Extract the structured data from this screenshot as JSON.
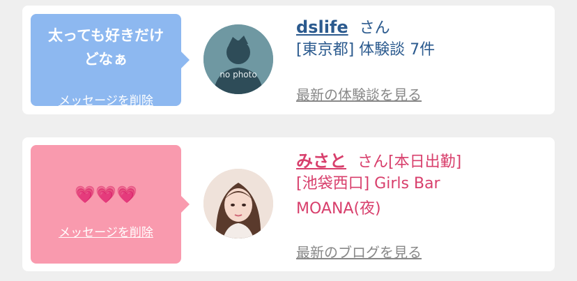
{
  "cards": [
    {
      "message_lines": [
        "太っても好きだけ",
        "どなぁ"
      ],
      "delete_label": "メッセージを削除",
      "avatar_caption": "no photo",
      "name": "dslife",
      "honorific": "さん",
      "details": [
        "[東京都] 体験談 7件"
      ],
      "link_label": "最新の体験談を見る"
    },
    {
      "message_lines": [
        "💗💗💗"
      ],
      "delete_label": "メッセージを削除",
      "name": "みさと",
      "honorific": "さん[本日出勤]",
      "details": [
        "[池袋西口] Girls Bar",
        "MOANA(夜)"
      ],
      "link_label": "最新のブログを見る"
    }
  ]
}
